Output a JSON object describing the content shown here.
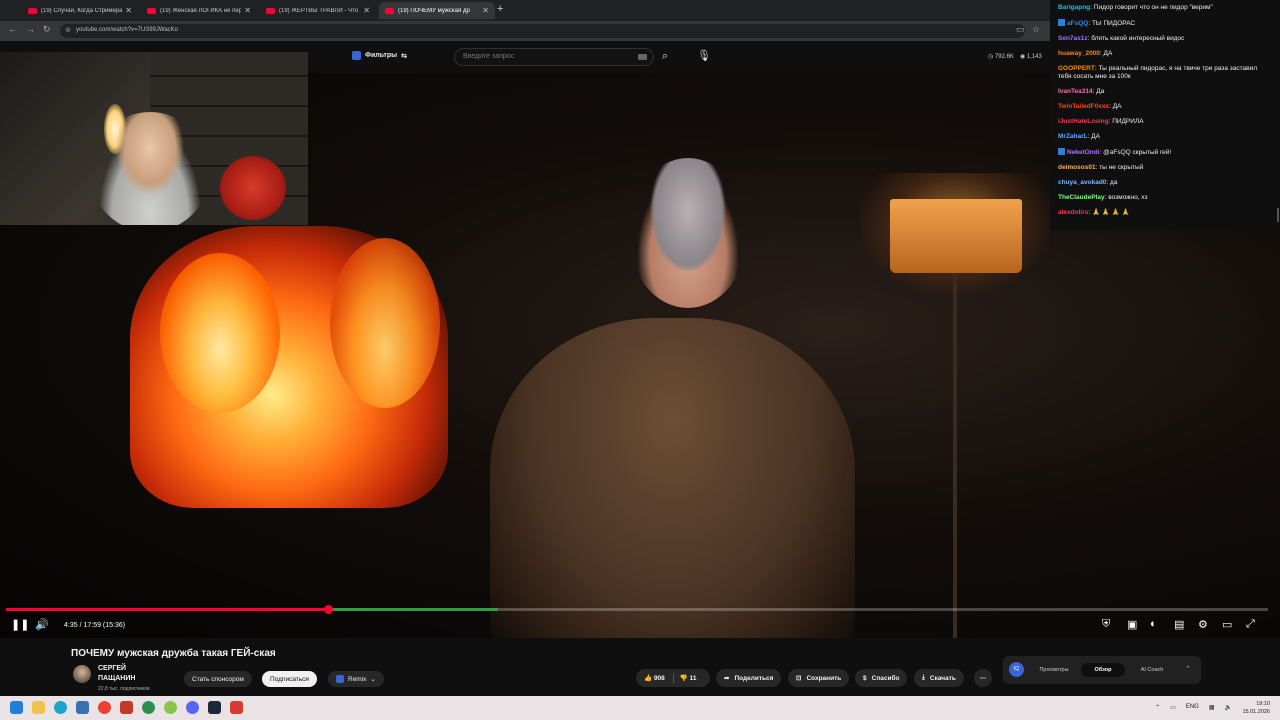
{
  "browser": {
    "tabs": [
      {
        "title": "(19) Случаи, Когда Стримерам",
        "active": false
      },
      {
        "title": "(19) Женская ЛОГИКА не пер",
        "active": false
      },
      {
        "title": "(19) ЖЕРТВЫ ТРАВЛИ - Что с",
        "active": false
      },
      {
        "title": "(19) ПОЧЕМУ мужская др",
        "active": true
      }
    ],
    "new_tab": "+",
    "url": "youtube.com/watch?v=7US99JWacKo"
  },
  "yt_header": {
    "filters_label": "Фильтры",
    "search_placeholder": "Введите запрос",
    "stats": {
      "views": "792.6K",
      "viewers": "1,143"
    }
  },
  "player": {
    "time": "4:35 / 17:59 (15:36)",
    "progress_fraction": 0.255,
    "buffered_fraction": 0.39
  },
  "video_info": {
    "title": "ПОЧЕМУ мужская дружба такая ГЕЙ-ская",
    "channel_name": "СЕРГЕЙ ПАЩАНИН",
    "subscribers": "22,8 тыс. подписчиков",
    "sponsor_label": "Стать спонсором",
    "subscribe_label": "Подписаться",
    "remix_label": "Remix",
    "likes": "908",
    "dislikes": "11",
    "share_label": "Поделиться",
    "save_label": "Сохранить",
    "thanks_label": "Спасибо",
    "download_label": "Скачать"
  },
  "ai_panel": {
    "icon_text": "IQ",
    "tabs": [
      "Просмотры",
      "Обзор",
      "AI Coach"
    ],
    "selected": "Обзор"
  },
  "chat": [
    {
      "user": "Barigapng",
      "color": "#00c8ff",
      "badge": false,
      "text": "Пидор говорит что он не пидор \"верим\""
    },
    {
      "user": "aFsQQ",
      "color": "#1e90ff",
      "badge": true,
      "text": "ТЫ ПИДОРАС"
    },
    {
      "user": "Sen7as1z",
      "color": "#9b7bff",
      "badge": false,
      "text": "блять какой интересный видос"
    },
    {
      "user": "huaway_2000",
      "color": "#ff7f27",
      "badge": false,
      "text": "ДА"
    },
    {
      "user": "GOOPPERT",
      "color": "#ff8c00",
      "badge": false,
      "text": "Ты реальный пидорас, я на твиче три раза заставил тебя сосать мне за 100к"
    },
    {
      "user": "IvanTea314",
      "color": "#ff69b4",
      "badge": false,
      "text": "Да"
    },
    {
      "user": "TwinTailedF0xxx",
      "color": "#ff4500",
      "badge": false,
      "text": "ДА"
    },
    {
      "user": "iJustHateLosing",
      "color": "#ff3355",
      "badge": false,
      "text": "ПИДРИЛА"
    },
    {
      "user": "MrZaharL",
      "color": "#5fa8ff",
      "badge": false,
      "text": "ДА"
    },
    {
      "user": "NeketOndi",
      "color": "#b070ff",
      "badge": true,
      "text": "@aFsQQ скрытый гей!"
    },
    {
      "user": "deimosos01",
      "color": "#ffb347",
      "badge": false,
      "text": "ты не скрытый"
    },
    {
      "user": "chuya_avokad0",
      "color": "#7fb7ff",
      "badge": false,
      "text": "да"
    },
    {
      "user": "TheClaudePlay",
      "color": "#7fff7f",
      "badge": false,
      "text": "возможно, хз"
    },
    {
      "user": "alexdolirs",
      "color": "#ff3355",
      "badge": false,
      "text": "🙏 🙏 🙏 🙏"
    }
  ],
  "taskbar": {
    "lang": "ENG",
    "time": "19:10",
    "date": "15.01.2026"
  }
}
